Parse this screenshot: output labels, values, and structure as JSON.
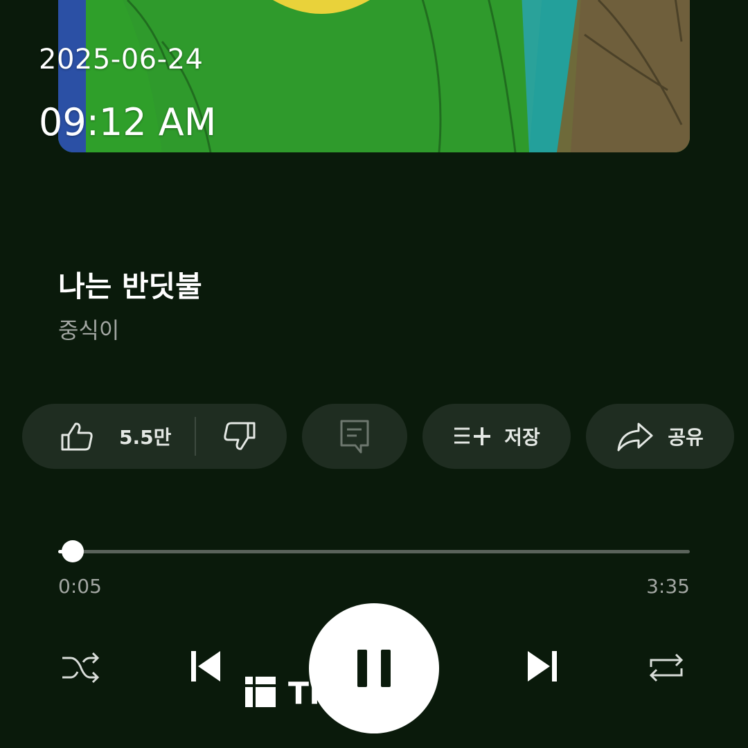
{
  "status": {
    "date": "2025-06-24",
    "time": "09:12 AM"
  },
  "track": {
    "title": "나는 반딧불",
    "artist": "중식이"
  },
  "actions": {
    "like_count": "5.5만",
    "save_label": "저장",
    "share_label": "공유"
  },
  "playback": {
    "elapsed": "0:05",
    "total": "3:35",
    "progress_fraction": 0.023,
    "state": "playing"
  },
  "watermark": {
    "text": "Threads"
  },
  "icons": {
    "like": "thumbs-up-icon",
    "dislike": "thumbs-down-icon",
    "comment": "comment-icon",
    "save": "playlist-add-icon",
    "share": "share-arrow-icon",
    "shuffle": "shuffle-icon",
    "previous": "skip-previous-icon",
    "pause": "pause-icon",
    "next": "skip-next-icon",
    "repeat": "repeat-icon"
  },
  "colors": {
    "background": "#0a1a0b",
    "chip": "#1f2d21",
    "secondary_text": "#a2a6a2",
    "progress_track": "#5a635b"
  }
}
